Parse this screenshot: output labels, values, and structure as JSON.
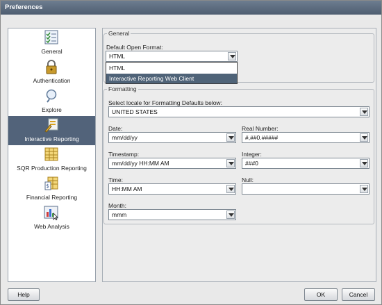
{
  "window": {
    "title": "Preferences"
  },
  "sidebar": {
    "items": [
      {
        "label": "General",
        "icon": "checklist-icon",
        "selected": false
      },
      {
        "label": "Authentication",
        "icon": "padlock-icon",
        "selected": false
      },
      {
        "label": "Explore",
        "icon": "magnifier-icon",
        "selected": false
      },
      {
        "label": "Interactive Reporting",
        "icon": "report-pen-icon",
        "selected": true
      },
      {
        "label": "SQR Production Reporting",
        "icon": "spreadsheet-icon",
        "selected": false
      },
      {
        "label": "Financial Reporting",
        "icon": "financial-report-icon",
        "selected": false
      },
      {
        "label": "Web Analysis",
        "icon": "bar-chart-icon",
        "selected": false
      }
    ]
  },
  "general": {
    "legend": "General",
    "default_open_format_label": "Default Open Format:",
    "default_open_format_value": "HTML",
    "dropdown_options": [
      "HTML",
      "Interactive Reporting Web Client"
    ],
    "dropdown_selected": "Interactive Reporting Web Client"
  },
  "formatting": {
    "legend": "Formatting",
    "locale_label": "Select locale for Formatting Defaults below:",
    "locale_value": "UNITED STATES",
    "date_label": "Date:",
    "date_value": "mm/dd/yy",
    "real_number_label": "Real Number:",
    "real_number_value": "#,##0.#####",
    "timestamp_label": "Timestamp:",
    "timestamp_value": "mm/dd/yy HH:MM AM",
    "integer_label": "Integer:",
    "integer_value": "###0",
    "time_label": "Time:",
    "time_value": "HH:MM AM",
    "null_label": "Null:",
    "null_value": "",
    "month_label": "Month:",
    "month_value": "mmm"
  },
  "buttons": {
    "help": "Help",
    "ok": "OK",
    "cancel": "Cancel"
  },
  "colors": {
    "titlebar": "#56667a",
    "selected_item": "#52637a"
  }
}
